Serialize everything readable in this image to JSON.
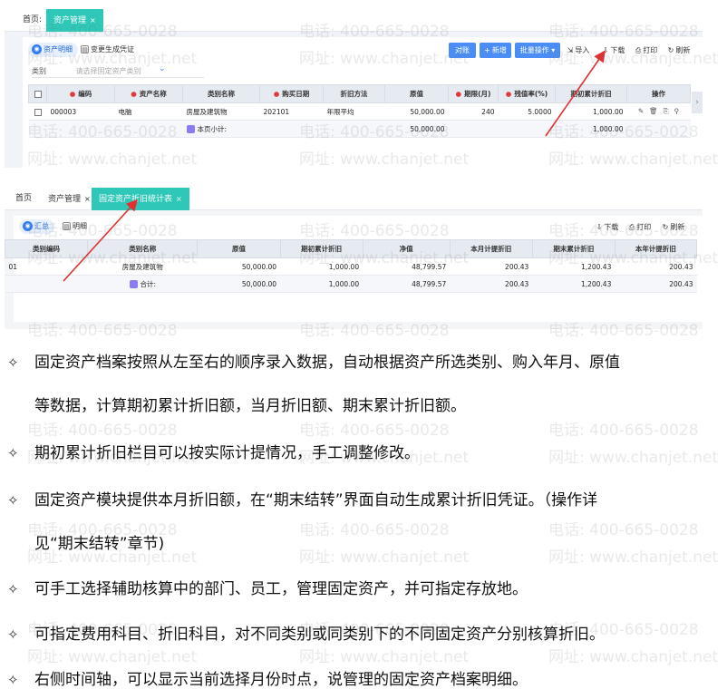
{
  "screenshot1": {
    "tabs": [
      {
        "label": "首页",
        "active": false
      },
      {
        "label": "资产管理",
        "active": true
      }
    ],
    "view_toggle": {
      "archive": "资产明细",
      "voucher": "变更生成凭证"
    },
    "toolbar": {
      "buttons": [
        "对账",
        "新增",
        "批量操作"
      ],
      "add_prefix": "+",
      "batch_suffix": "▾",
      "actions": [
        "导入",
        "下载",
        "打印",
        "刷新"
      ]
    },
    "filter": {
      "label": "类别",
      "placeholder": "请选择固定资产类别"
    },
    "table": {
      "columns": [
        "编码",
        "资产名称",
        "类别名称",
        "购买日期",
        "折旧方法",
        "原值",
        "期限(月)",
        "残值率(%)",
        "期初累计折旧",
        "操作"
      ],
      "required": [
        true,
        true,
        false,
        true,
        false,
        false,
        true,
        true,
        false,
        false
      ],
      "row": {
        "code": "000003",
        "name": "电脑",
        "category": "房屋及建筑物",
        "date": "202101",
        "method": "年限平均",
        "original": "50,000.00",
        "months": "240",
        "residual": "5.0000",
        "accum": "1,000.00"
      },
      "subtotal": {
        "label": "本页小计:",
        "original": "50,000.00",
        "accum": "1,000.00"
      }
    }
  },
  "screenshot2": {
    "tabs": [
      {
        "label": "首页",
        "active": false
      },
      {
        "label": "资产管理",
        "active": false
      },
      {
        "label": "固定资产折旧统计表",
        "active": true
      }
    ],
    "view_toggle": {
      "summary": "汇总",
      "detail": "明细"
    },
    "actions": [
      "下载",
      "打印",
      "刷新"
    ],
    "table": {
      "columns": [
        "类别编码",
        "类别名称",
        "原值",
        "期初累计折旧",
        "净值",
        "本月计提折旧",
        "期末累计折旧",
        "本年计提折旧"
      ],
      "row": {
        "code": "01",
        "name": "房屋及建筑物",
        "original": "50,000.00",
        "opening": "1,000.00",
        "net": "48,799.57",
        "month": "200.43",
        "closing": "1,200.43",
        "year": "200.43"
      },
      "total": {
        "label": "合计:",
        "original": "50,000.00",
        "opening": "1,000.00",
        "net": "48,799.57",
        "month": "200.43",
        "closing": "1,200.43",
        "year": "200.43"
      }
    }
  },
  "watermark": {
    "phone": "电话: 400-665-0028",
    "site": "网址: www.chanjet.net"
  },
  "notes": {
    "marker": "✧",
    "items": [
      {
        "line1": "固定资产档案按照从左至右的顺序录入数据，自动根据资产所选类别、购入年月、原值",
        "line2": "等数据，计算期初累计折旧额，当月折旧额、期末累计折旧额。"
      },
      {
        "line1": "期初累计折旧栏目可以按实际计提情况，手工调整修改。",
        "line2": ""
      },
      {
        "line1": "固定资产模块提供本月折旧额，在“期末结转”界面自动生成累计折旧凭证。（操作详",
        "line2": "见“期末结转”章节)"
      },
      {
        "line1": "可手工选择辅助核算中的部门、员工，管理固定资产，并可指定存放地。",
        "line2": ""
      },
      {
        "line1": "可指定费用科目、折旧科目，对不同类别或同类别下的不同固定资产分别核算折旧。",
        "line2": ""
      },
      {
        "line1": "右侧时间轴，可以显示当前选择月份时点，说管理的固定资产档案明细。",
        "line2": ""
      }
    ]
  },
  "colors": {
    "tab_active": "#2fc7b7",
    "primary": "#4a8df5",
    "arrow": "#e0302f"
  }
}
